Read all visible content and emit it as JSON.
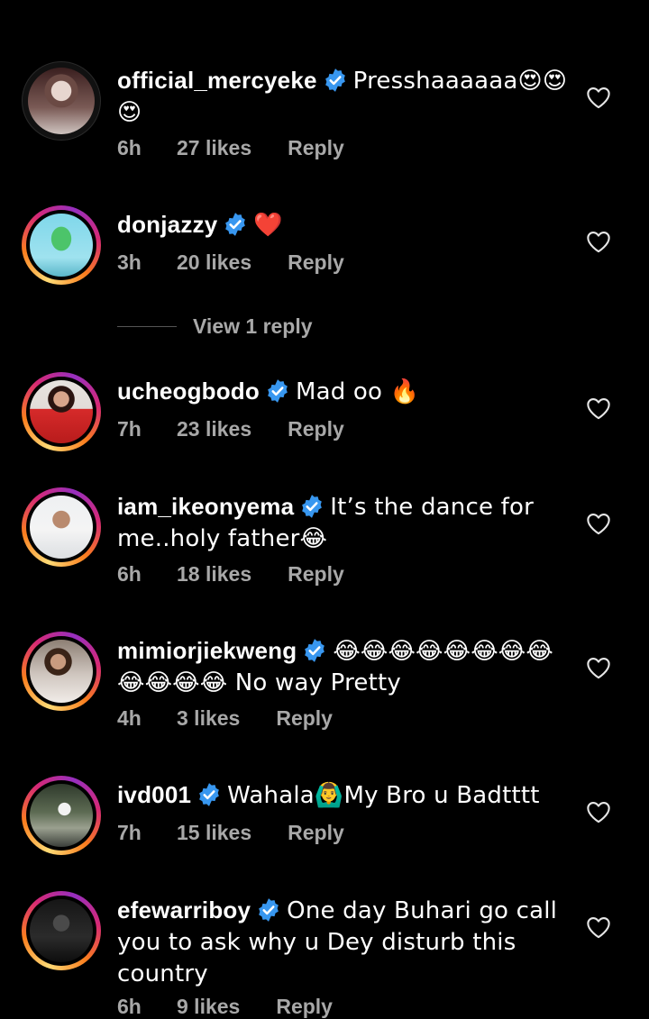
{
  "comments": [
    {
      "username": "official_mercyeke",
      "text": "Presshaaaaaa😍😍😍",
      "time": "6h",
      "likes": "27 likes",
      "reply": "Reply",
      "story_ring": false
    },
    {
      "username": "donjazzy",
      "text": "❤️",
      "time": "3h",
      "likes": "20 likes",
      "reply": "Reply",
      "story_ring": true,
      "view_replies": "View 1 reply"
    },
    {
      "username": "ucheogbodo",
      "text": "Mad oo 🔥",
      "time": "7h",
      "likes": "23 likes",
      "reply": "Reply",
      "story_ring": true
    },
    {
      "username": "iam_ikeonyema",
      "text": "It’s the dance for me..holy father😂",
      "time": "6h",
      "likes": "18 likes",
      "reply": "Reply",
      "story_ring": true
    },
    {
      "username": "mimiorjiekweng",
      "text": "😂😂😂😂😂😂😂😂😂😂😂😂 No way Pretty",
      "time": "4h",
      "likes": "3 likes",
      "reply": "Reply",
      "story_ring": true
    },
    {
      "username": "ivd001",
      "text": "Wahala🙆‍♂️My Bro u Badtttt",
      "time": "7h",
      "likes": "15 likes",
      "reply": "Reply",
      "story_ring": true
    },
    {
      "username": "efewarriboy",
      "text": "One day Buhari go call you to ask why u Dey disturb this country",
      "time": "6h",
      "likes": "9 likes",
      "reply": "Reply",
      "story_ring": true
    }
  ],
  "colors": {
    "background": "#000000",
    "verified_badge": "#3897f0",
    "meta_text": "#a8a8a8"
  },
  "icons": {
    "verified": "verified-badge-icon",
    "like": "heart-outline-icon"
  }
}
